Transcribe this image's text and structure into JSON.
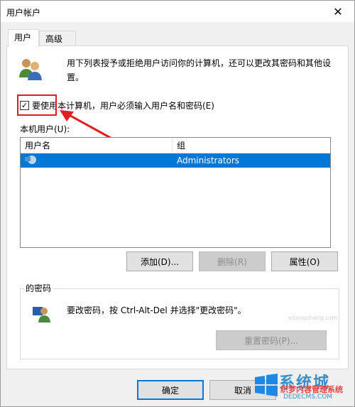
{
  "window": {
    "title": "用户帐户",
    "close_glyph": "✕"
  },
  "tabs": [
    {
      "label": "用户",
      "active": true
    },
    {
      "label": "高级",
      "active": false
    }
  ],
  "intro": {
    "text": "用下列表授予或拒绝用户访问你的计算机，还可以更改其密码和其他设置。"
  },
  "require_login": {
    "checked": true,
    "check_glyph": "✓",
    "label": "要使用本计算机，用户必须输入用户名和密码(E)"
  },
  "local_users": {
    "label": "本机用户(U):",
    "columns": [
      "用户名",
      "组"
    ],
    "rows": [
      {
        "name": "",
        "group": "Administrators",
        "selected": true
      }
    ]
  },
  "buttons": {
    "add": "添加(D)...",
    "remove": "删除(R)",
    "properties": "属性(O)",
    "reset_password": "重置密码(P)...",
    "ok": "确定",
    "cancel": "取消"
  },
  "password_group": {
    "title": "的密码",
    "text": "要改密码，按 Ctrl-Alt-Del 并选择\"更改密码\"。"
  },
  "watermarks": {
    "brand": "系统城",
    "site_cn": "织梦内容管理系统",
    "site_en": "DEDECMS.COM",
    "side": "xitongcheng.com"
  },
  "colors": {
    "accent": "#0078d7",
    "highlight": "#e02020"
  }
}
